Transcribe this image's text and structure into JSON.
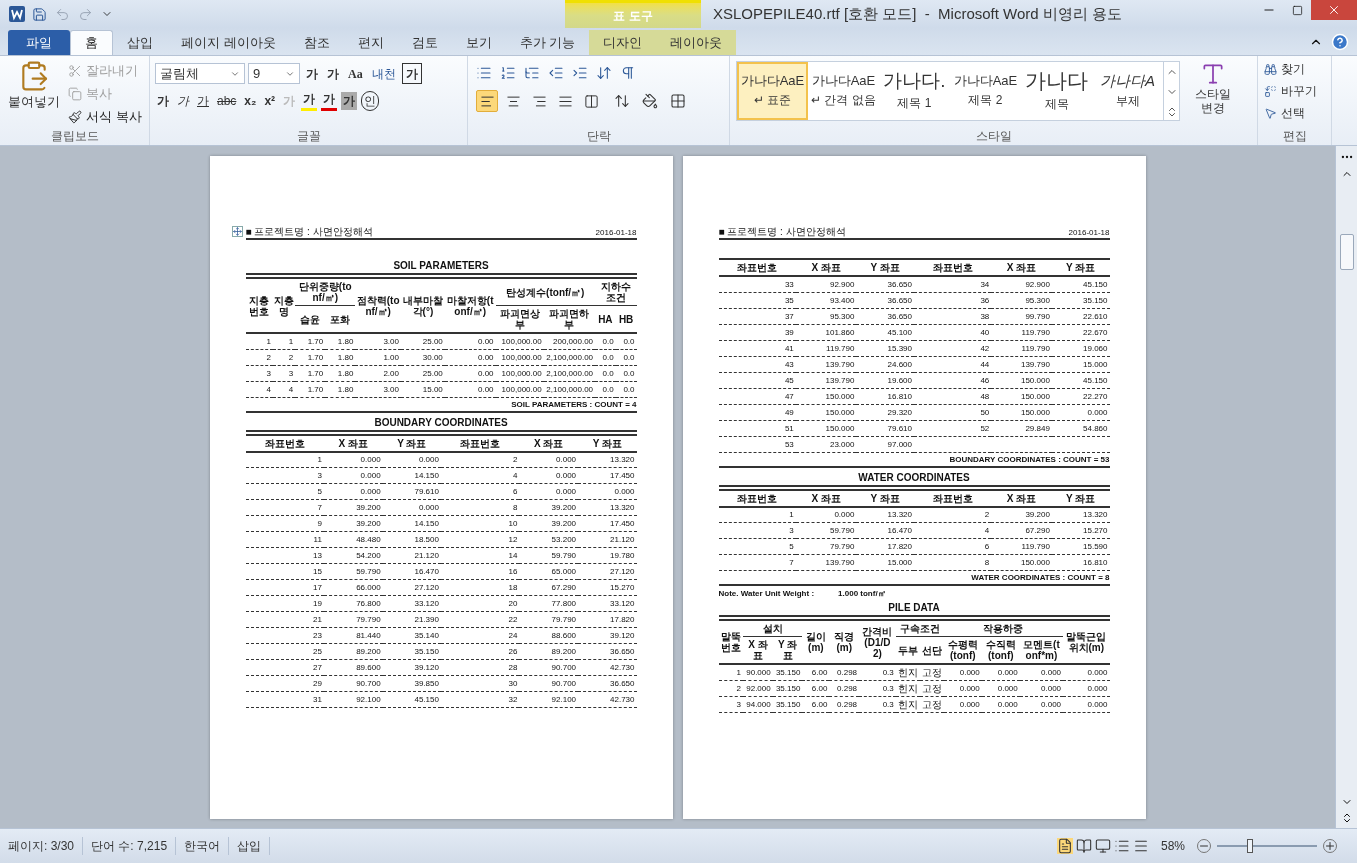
{
  "title_bar": {
    "title": "XSLOPEPILE40.rtf [호환 모드]  -  Microsoft Word 비영리 용도",
    "context_label": "표 도구"
  },
  "tabs": [
    {
      "label": "파일",
      "kind": "file",
      "selected": false
    },
    {
      "label": "홈",
      "kind": "normal",
      "selected": true
    },
    {
      "label": "삽입",
      "kind": "normal",
      "selected": false
    },
    {
      "label": "페이지 레이아웃",
      "kind": "normal",
      "selected": false
    },
    {
      "label": "참조",
      "kind": "normal",
      "selected": false
    },
    {
      "label": "편지",
      "kind": "normal",
      "selected": false
    },
    {
      "label": "검토",
      "kind": "normal",
      "selected": false
    },
    {
      "label": "보기",
      "kind": "normal",
      "selected": false
    },
    {
      "label": "추가 기능",
      "kind": "normal",
      "selected": false
    },
    {
      "label": "디자인",
      "kind": "context",
      "selected": false
    },
    {
      "label": "레이아웃",
      "kind": "context",
      "selected": false
    }
  ],
  "clipboard": {
    "title": "클립보드",
    "paste": "붙여넣기",
    "items": [
      {
        "label": "잘라내기",
        "kind": "cut",
        "disabled": true
      },
      {
        "label": "복사",
        "kind": "copy",
        "disabled": true
      },
      {
        "label": "서식 복사",
        "kind": "painter",
        "disabled": false
      }
    ]
  },
  "font": {
    "title": "글꼴",
    "font_name": "굴림체",
    "font_size": "9",
    "row1": [
      {
        "label": "가",
        "kind": "grow"
      },
      {
        "label": "가",
        "kind": "shrink"
      },
      {
        "label": "Aa",
        "kind": "case"
      },
      {
        "label": "내천",
        "kind": "phonetic"
      },
      {
        "label": "가",
        "kind": "boxed"
      }
    ],
    "row2": [
      {
        "label": "가",
        "kind": "bold"
      },
      {
        "label": "가",
        "kind": "italic"
      },
      {
        "label": "가",
        "kind": "underline"
      },
      {
        "label": "abc",
        "kind": "strike"
      },
      {
        "label": "x₂",
        "kind": "plain"
      },
      {
        "label": "x²",
        "kind": "plain"
      },
      {
        "label": "가",
        "kind": "effects"
      },
      {
        "label": "가",
        "kind": "highlight"
      },
      {
        "label": "가",
        "kind": "color"
      },
      {
        "label": "가",
        "kind": "shaded"
      },
      {
        "label": "인",
        "kind": "circled"
      }
    ]
  },
  "paragraph": {
    "title": "단락",
    "alignments": [
      {
        "kind": "left",
        "selected": true
      },
      {
        "kind": "center",
        "selected": false
      },
      {
        "kind": "right",
        "selected": false
      },
      {
        "kind": "justify",
        "selected": false
      },
      {
        "kind": "distribute",
        "selected": false
      }
    ]
  },
  "styles": {
    "title": "스타일",
    "change": "스타일 변경",
    "items": [
      {
        "preview": "가나다AaE",
        "name": "↵ 표준",
        "kind": "normal",
        "selected": true
      },
      {
        "preview": "가나다AaE",
        "name": "↵ 간격 없음",
        "kind": "normal",
        "selected": false
      },
      {
        "preview": "가나다.",
        "name": "제목 1",
        "kind": "large",
        "selected": false
      },
      {
        "preview": "가나다AaE",
        "name": "제목 2",
        "kind": "normal",
        "selected": false
      },
      {
        "preview": "가나다",
        "name": "제목",
        "kind": "xlarge",
        "selected": false
      },
      {
        "preview": "가나다A",
        "name": "부제",
        "kind": "italic",
        "selected": false
      }
    ]
  },
  "editing": {
    "title": "편집",
    "items": [
      {
        "label": "찾기",
        "kind": "find"
      },
      {
        "label": "바꾸기",
        "kind": "replace"
      },
      {
        "label": "선택",
        "kind": "select"
      }
    ]
  },
  "pages": [
    {
      "blocks": [
        {
          "kind": "header",
          "left": "■ 프로젝트명 : 사면안정해석",
          "right": "2016-01-18"
        },
        {
          "kind": "title",
          "text": "SOIL PARAMETERS"
        },
        {
          "kind": "table",
          "header_rows": [
            [
              {
                "label": "지층번호",
                "rowspan": 2
              },
              {
                "label": "지층명",
                "rowspan": 2
              },
              {
                "label": "단위중량(tonf/㎥)",
                "colspan": 2
              },
              {
                "label": "점착력(tonf/㎡)",
                "rowspan": 2
              },
              {
                "label": "내부마찰각(°)",
                "rowspan": 2
              },
              {
                "label": "마찰저항(tonf/㎡)",
                "rowspan": 2
              },
              {
                "label": "탄성계수(tonf/㎡)",
                "colspan": 2
              },
              {
                "label": "지하수조건",
                "colspan": 2
              }
            ],
            [
              {
                "label": "습윤"
              },
              {
                "label": "포화"
              },
              {
                "label": "파괴면상부"
              },
              {
                "label": "파괴면하부"
              },
              {
                "label": "HA"
              },
              {
                "label": "HB"
              }
            ]
          ],
          "rows": [
            [
              "1",
              "1",
              "1.70",
              "1.80",
              "3.00",
              "25.00",
              "0.00",
              "100,000.00",
              "200,000.00",
              "0.0",
              "0.0"
            ],
            [
              "2",
              "2",
              "1.70",
              "1.80",
              "1.00",
              "30.00",
              "0.00",
              "100,000.00",
              "2,100,000.00",
              "0.0",
              "0.0"
            ],
            [
              "3",
              "3",
              "1.70",
              "1.80",
              "2.00",
              "25.00",
              "0.00",
              "100,000.00",
              "2,100,000.00",
              "0.0",
              "0.0"
            ],
            [
              "4",
              "4",
              "1.70",
              "1.80",
              "3.00",
              "15.00",
              "0.00",
              "100,000.00",
              "2,100,000.00",
              "0.0",
              "0.0"
            ]
          ]
        },
        {
          "kind": "count",
          "text": "SOIL PARAMETERS  : COUNT = 4"
        },
        {
          "kind": "title",
          "text": "BOUNDARY COORDINATES"
        },
        {
          "kind": "table",
          "header_rows": [
            [
              {
                "label": "좌표번호"
              },
              {
                "label": "X 좌표"
              },
              {
                "label": "Y 좌표"
              },
              {
                "label": "좌표번호"
              },
              {
                "label": "X 좌표"
              },
              {
                "label": "Y 좌표"
              }
            ]
          ],
          "rows": [
            [
              "1",
              "0.000",
              "0.000",
              "2",
              "0.000",
              "13.320"
            ],
            [
              "3",
              "0.000",
              "14.150",
              "4",
              "0.000",
              "17.450"
            ],
            [
              "5",
              "0.000",
              "79.610",
              "6",
              "0.000",
              "0.000"
            ],
            [
              "7",
              "39.200",
              "0.000",
              "8",
              "39.200",
              "13.320"
            ],
            [
              "9",
              "39.200",
              "14.150",
              "10",
              "39.200",
              "17.450"
            ],
            [
              "11",
              "48.480",
              "18.500",
              "12",
              "53.200",
              "21.120"
            ],
            [
              "13",
              "54.200",
              "21.120",
              "14",
              "59.790",
              "19.780"
            ],
            [
              "15",
              "59.790",
              "16.470",
              "16",
              "65.000",
              "27.120"
            ],
            [
              "17",
              "66.000",
              "27.120",
              "18",
              "67.290",
              "15.270"
            ],
            [
              "19",
              "76.800",
              "33.120",
              "20",
              "77.800",
              "33.120"
            ],
            [
              "21",
              "79.790",
              "21.390",
              "22",
              "79.790",
              "17.820"
            ],
            [
              "23",
              "81.440",
              "35.140",
              "24",
              "88.600",
              "39.120"
            ],
            [
              "25",
              "89.200",
              "35.150",
              "26",
              "89.200",
              "36.650"
            ],
            [
              "27",
              "89.600",
              "39.120",
              "28",
              "90.700",
              "42.730"
            ],
            [
              "29",
              "90.700",
              "39.850",
              "30",
              "90.700",
              "36.650"
            ],
            [
              "31",
              "92.100",
              "45.150",
              "32",
              "92.100",
              "42.730"
            ]
          ]
        }
      ]
    },
    {
      "blocks": [
        {
          "kind": "header",
          "left": "■ 프로젝트명 : 사면안정해석",
          "right": "2016-01-18"
        },
        {
          "kind": "table",
          "header_rows": [
            [
              {
                "label": "좌표번호"
              },
              {
                "label": "X 좌표"
              },
              {
                "label": "Y 좌표"
              },
              {
                "label": "좌표번호"
              },
              {
                "label": "X 좌표"
              },
              {
                "label": "Y 좌표"
              }
            ]
          ],
          "rows": [
            [
              "33",
              "92.900",
              "36.650",
              "34",
              "92.900",
              "45.150"
            ],
            [
              "35",
              "93.400",
              "36.650",
              "36",
              "95.300",
              "35.150"
            ],
            [
              "37",
              "95.300",
              "36.650",
              "38",
              "99.790",
              "22.610"
            ],
            [
              "39",
              "101.860",
              "45.100",
              "40",
              "119.790",
              "22.670"
            ],
            [
              "41",
              "119.790",
              "15.390",
              "42",
              "119.790",
              "19.060"
            ],
            [
              "43",
              "139.790",
              "24.600",
              "44",
              "139.790",
              "15.000"
            ],
            [
              "45",
              "139.790",
              "19.600",
              "46",
              "150.000",
              "45.150"
            ],
            [
              "47",
              "150.000",
              "16.810",
              "48",
              "150.000",
              "22.270"
            ],
            [
              "49",
              "150.000",
              "29.320",
              "50",
              "150.000",
              "0.000"
            ],
            [
              "51",
              "150.000",
              "79.610",
              "52",
              "29.849",
              "54.860"
            ],
            [
              "53",
              "23.000",
              "97.000"
            ]
          ]
        },
        {
          "kind": "count",
          "text": "BOUNDARY COORDINATES : COUNT = 53"
        },
        {
          "kind": "title",
          "text": "WATER COORDINATES"
        },
        {
          "kind": "table",
          "header_rows": [
            [
              {
                "label": "좌표번호"
              },
              {
                "label": "X 좌표"
              },
              {
                "label": "Y 좌표"
              },
              {
                "label": "좌표번호"
              },
              {
                "label": "X 좌표"
              },
              {
                "label": "Y 좌표"
              }
            ]
          ],
          "rows": [
            [
              "1",
              "0.000",
              "13.320",
              "2",
              "39.200",
              "13.320"
            ],
            [
              "3",
              "59.790",
              "16.470",
              "4",
              "67.290",
              "15.270"
            ],
            [
              "5",
              "79.790",
              "17.820",
              "6",
              "119.790",
              "15.590"
            ],
            [
              "7",
              "139.790",
              "15.000",
              "8",
              "150.000",
              "16.810"
            ]
          ]
        },
        {
          "kind": "count",
          "text": "WATER COORDINATES : COUNT = 8"
        },
        {
          "kind": "note",
          "label": "Note. Water Unit Weight :",
          "value": "1.000 tonf/㎥"
        },
        {
          "kind": "title",
          "text": "PILE DATA"
        },
        {
          "kind": "table",
          "header_rows": [
            [
              {
                "label": "말뚝번호",
                "rowspan": 2
              },
              {
                "label": "설치",
                "colspan": 2
              },
              {
                "label": "길이(m)",
                "rowspan": 2
              },
              {
                "label": "직경(m)",
                "rowspan": 2
              },
              {
                "label": "간격비(D1/D2)",
                "rowspan": 2
              },
              {
                "label": "구속조건",
                "colspan": 2
              },
              {
                "label": "작용하중",
                "colspan": 3
              },
              {
                "label": "말뚝근입위치(m)",
                "rowspan": 2
              }
            ],
            [
              {
                "label": "X 좌표"
              },
              {
                "label": "Y 좌표"
              },
              {
                "label": "두부"
              },
              {
                "label": "선단"
              },
              {
                "label": "수평력(tonf)"
              },
              {
                "label": "수직력(tonf)"
              },
              {
                "label": "모멘트(tonf*m)"
              }
            ]
          ],
          "rows": [
            [
              "1",
              "90.000",
              "35.150",
              "6.00",
              "0.298",
              "0.3",
              "힌지",
              "고정",
              "0.000",
              "0.000",
              "0.000",
              "0.000"
            ],
            [
              "2",
              "92.000",
              "35.150",
              "6.00",
              "0.298",
              "0.3",
              "힌지",
              "고정",
              "0.000",
              "0.000",
              "0.000",
              "0.000"
            ],
            [
              "3",
              "94.000",
              "35.150",
              "6.00",
              "0.298",
              "0.3",
              "힌지",
              "고정",
              "0.000",
              "0.000",
              "0.000",
              "0.000"
            ]
          ]
        }
      ]
    }
  ],
  "status_bar": {
    "items": [
      "페이지: 3/30",
      "단어 수: 7,215",
      "한국어",
      "삽입"
    ],
    "zoom": {
      "label": "58%",
      "level": 0.3
    }
  }
}
